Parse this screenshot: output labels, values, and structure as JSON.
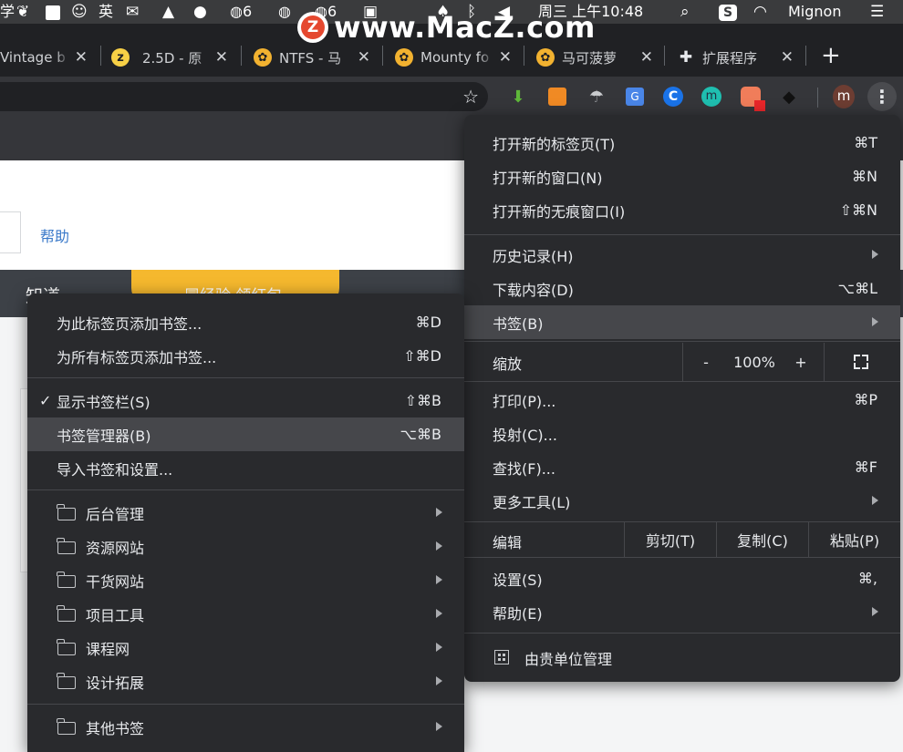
{
  "menubar": {
    "items": [
      {
        "label": "学"
      },
      {
        "label": "英"
      },
      {
        "label": "6"
      },
      {
        "label": "6"
      },
      {
        "label": "周三 上午10:48"
      },
      {
        "label": "Mignon"
      }
    ]
  },
  "watermark": {
    "logo": "Z",
    "text": "www.MacZ.com"
  },
  "tabs": [
    {
      "title": "Vintage b",
      "favicon": "none"
    },
    {
      "title": "2.5D - 原",
      "favicon": "z"
    },
    {
      "title": "NTFS - 马",
      "favicon": "pineapple"
    },
    {
      "title": "Mounty fo",
      "favicon": "pineapple"
    },
    {
      "title": "马可菠萝",
      "favicon": "pineapple"
    },
    {
      "title": "扩展程序",
      "favicon": "puzzle"
    }
  ],
  "new_tab": "+",
  "page": {
    "help": "帮助",
    "zhidao": "知道",
    "promo": "冒经验 领红包"
  },
  "toolbar": {
    "avatar": "m"
  },
  "main_menu": {
    "items": [
      {
        "label": "打开新的标签页(T)",
        "shortcut": "⌘T"
      },
      {
        "label": "打开新的窗口(N)",
        "shortcut": "⌘N"
      },
      {
        "label": "打开新的无痕窗口(I)",
        "shortcut": "⇧⌘N"
      },
      {
        "label": "历史记录(H)",
        "shortcut": ""
      },
      {
        "label": "下载内容(D)",
        "shortcut": "⌥⌘L"
      },
      {
        "label": "书签(B)",
        "shortcut": ""
      }
    ],
    "zoom": {
      "label": "缩放",
      "minus": "-",
      "value": "100%",
      "plus": "+"
    },
    "items2": [
      {
        "label": "打印(P)...",
        "shortcut": "⌘P"
      },
      {
        "label": "投射(C)...",
        "shortcut": ""
      },
      {
        "label": "查找(F)...",
        "shortcut": "⌘F"
      },
      {
        "label": "更多工具(L)",
        "shortcut": ""
      }
    ],
    "edit": {
      "label": "编辑",
      "cut": "剪切(T)",
      "copy": "复制(C)",
      "paste": "粘贴(P)"
    },
    "items3": [
      {
        "label": "设置(S)",
        "shortcut": "⌘,"
      },
      {
        "label": "帮助(E)",
        "shortcut": ""
      }
    ],
    "managed": "由贵单位管理"
  },
  "bookmark_menu": {
    "items": [
      {
        "label": "为此标签页添加书签...",
        "shortcut": "⌘D"
      },
      {
        "label": "为所有标签页添加书签...",
        "shortcut": "⇧⌘D"
      },
      {
        "label": "显示书签栏(S)",
        "shortcut": "⇧⌘B",
        "checked": true
      },
      {
        "label": "书签管理器(B)",
        "shortcut": "⌥⌘B"
      },
      {
        "label": "导入书签和设置...",
        "shortcut": ""
      }
    ],
    "folders": [
      {
        "label": "后台管理"
      },
      {
        "label": "资源网站"
      },
      {
        "label": "干货网站"
      },
      {
        "label": "项目工具"
      },
      {
        "label": "课程网"
      },
      {
        "label": "设计拓展"
      }
    ],
    "other": "其他书签",
    "check_mark": "✓"
  }
}
